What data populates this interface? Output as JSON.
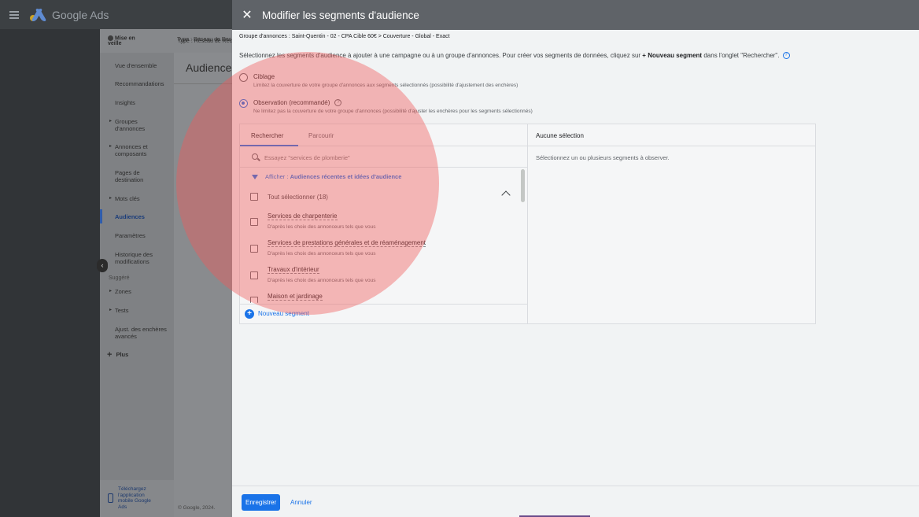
{
  "app": {
    "title": "Google Ads"
  },
  "nav_header": {
    "status": "Mise en veille",
    "type_label": "Type : Réseau de Rec"
  },
  "nav": {
    "items": [
      {
        "label": "Vue d'ensemble"
      },
      {
        "label": "Recommandations"
      },
      {
        "label": "Insights"
      },
      {
        "label": "Groupes d'annonces"
      },
      {
        "label": "Annonces et composants"
      },
      {
        "label": "Pages de destination"
      },
      {
        "label": "Mots clés"
      },
      {
        "label": "Audiences"
      },
      {
        "label": "Paramètres"
      },
      {
        "label": "Historique des modifications"
      },
      {
        "label": "Zones"
      },
      {
        "label": "Tests"
      },
      {
        "label": "Ajust. des enchères avancés"
      }
    ],
    "suggested_label": "Suggéré",
    "more_label": "Plus",
    "download_label": "Téléchargez l'application mobile Google Ads"
  },
  "background_page": {
    "title": "Audiences",
    "copyright": "© Google, 2024."
  },
  "panel": {
    "title": "Modifier les segments d'audience",
    "breadcrumb": "Groupe d'annonces : Saint-Quentin - 02 - CPA Cible 60€ > Couverture - Global - Exact",
    "intro_prefix": "Sélectionnez les segments d'audience à ajouter à une campagne ou à un groupe d'annonces. Pour créer vos segments de données, cliquez sur",
    "intro_bold": "+ Nouveau segment",
    "intro_suffix": "dans l'onglet \"Rechercher\".",
    "options": {
      "targeting": {
        "label": "Ciblage",
        "description": "Limitez la couverture de votre groupe d'annonces aux segments sélectionnés (possibilité d'ajustement des enchères)",
        "selected": false
      },
      "observation": {
        "label": "Observation (recommandé)",
        "description": "Ne limitez pas la couverture de votre groupe d'annonces (possibilité d'ajuster les enchères pour les segments sélectionnés)",
        "selected": true
      }
    },
    "tabs": [
      {
        "label": "Rechercher"
      },
      {
        "label": "Parcourir"
      }
    ],
    "search": {
      "placeholder": "Essayez \"services de plomberie\""
    },
    "filter": {
      "prefix": "Afficher :",
      "value": "Audiences récentes et idées d'audience"
    },
    "select_all": {
      "label": "Tout sélectionner (18)"
    },
    "segments": [
      {
        "label": "Services de charpenterie",
        "description": "D'après les choix des annonceurs tels que vous"
      },
      {
        "label": "Services de prestations générales et de réaménagement",
        "description": "D'après les choix des annonceurs tels que vous"
      },
      {
        "label": "Travaux d'intérieur",
        "description": "D'après les choix des annonceurs tels que vous"
      },
      {
        "label": "Maison et jardinage",
        "description": ""
      }
    ],
    "new_segment": {
      "label": "Nouveau segment"
    },
    "selection": {
      "header": "Aucune sélection",
      "empty_text": "Sélectionnez un ou plusieurs segments à observer."
    },
    "footer": {
      "save_label": "Enregistrer",
      "cancel_label": "Annuler"
    }
  },
  "colors": {
    "accent": "#1a73e8",
    "highlight": "#f05a5a",
    "panel_header": "#5f6368"
  }
}
